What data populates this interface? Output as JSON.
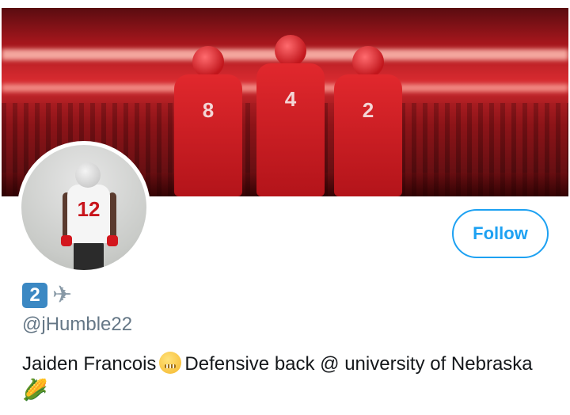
{
  "profile": {
    "name_emoji_key": "2",
    "name_emoji_plane": "✈",
    "handle": "@jHumble22",
    "bio_part1": "Jaiden Francois",
    "bio_part2": "Defensive back @ university of Nebraska",
    "bio_corn": "🌽",
    "follow_label": "Follow"
  },
  "banner": {
    "player_numbers": [
      "8",
      "4",
      "2"
    ]
  },
  "avatar": {
    "jersey_number": "12"
  },
  "colors": {
    "accent": "#1da1f2",
    "handle": "#657786",
    "text": "#14171a",
    "banner_red": "#d62a2f"
  },
  "icons": [
    "keycap-2-icon",
    "airplane-icon",
    "zipper-mouth-face-icon",
    "corn-icon"
  ]
}
